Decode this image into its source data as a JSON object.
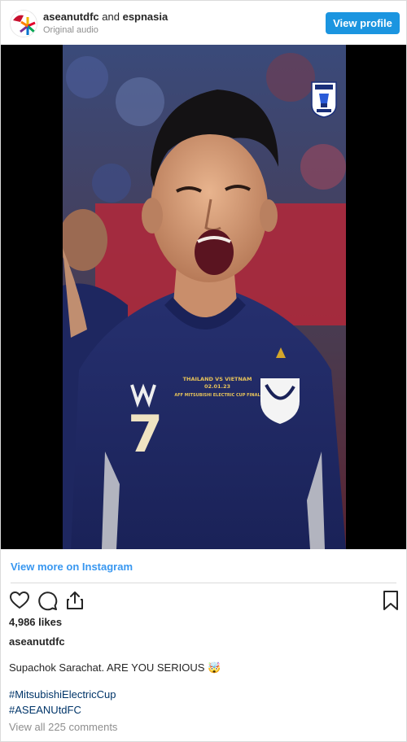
{
  "header": {
    "username": "aseanutdfc",
    "connector": "and",
    "collaborator": "espnasia",
    "audio": "Original audio",
    "view_profile_label": "View profile"
  },
  "video": {
    "jersey_number": "7",
    "jersey_text_line1": "THAILAND VS VIETNAM",
    "jersey_text_line2": "02.01.23",
    "jersey_text_line3": "AFF MITSUBISHI ELECTRIC CUP FINAL"
  },
  "footer": {
    "view_more": "View more on Instagram",
    "likes": "4,986 likes",
    "owner": "aseanutdfc",
    "caption": "Supachok Sarachat. ARE YOU SERIOUS",
    "caption_emoji": "🤯",
    "hashtags": [
      "#MitsubishiElectricCup",
      "#ASEANUtdFC"
    ],
    "comments": "View all 225 comments"
  },
  "icons": {
    "like": "heart-icon",
    "comment": "comment-icon",
    "share": "share-icon",
    "save": "bookmark-icon"
  },
  "colors": {
    "accent": "#1b95e0",
    "link": "#3897f0",
    "hashtag": "#003569",
    "jersey": "#1f2a6b"
  }
}
